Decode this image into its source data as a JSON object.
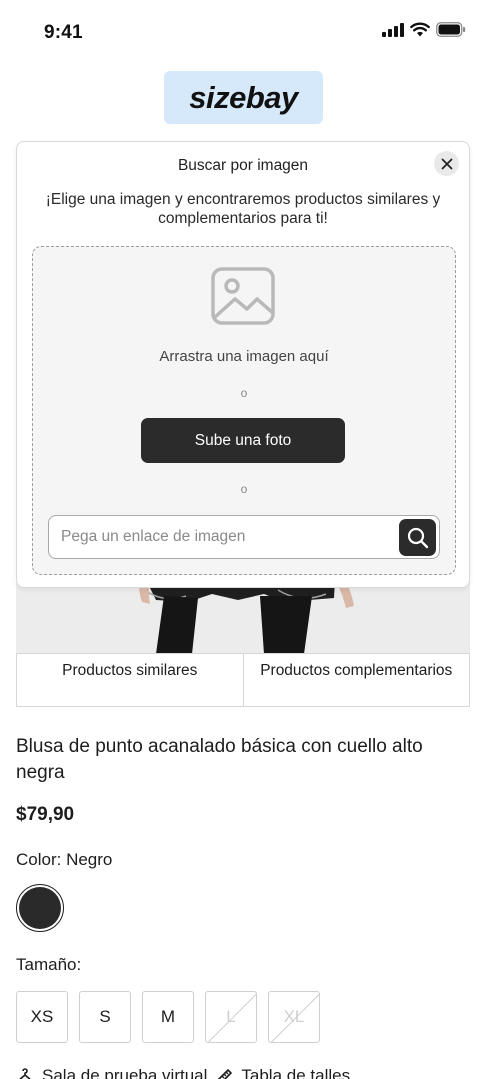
{
  "status_bar": {
    "time": "9:41"
  },
  "brand": {
    "logo_text": "sizebay",
    "accent_color": "#d6e9fb"
  },
  "tabs": [
    {
      "label": "Productos similares"
    },
    {
      "label": "Productos complementarios"
    }
  ],
  "modal": {
    "title": "Buscar por imagen",
    "description": "¡Elige una imagen y encontraremos productos similares y complementarios para ti!",
    "drag_text": "Arrastra una imagen aquí",
    "or_text_1": "o",
    "upload_button": "Sube una foto",
    "or_text_2": "o",
    "url_placeholder": "Pega un enlace de imagen",
    "url_value": "",
    "icons": {
      "close": "close-icon",
      "image": "image-placeholder-icon",
      "search": "search-icon"
    }
  },
  "product": {
    "title": "Blusa de punto acanalado básica con cuello alto negra",
    "price": "$79,90",
    "color_label": "Color: Negro",
    "color_swatch": "#2a2a2a",
    "size_label": "Tamaño:",
    "sizes": [
      {
        "label": "XS",
        "available": true
      },
      {
        "label": "S",
        "available": true
      },
      {
        "label": "M",
        "available": true
      },
      {
        "label": "L",
        "available": false
      },
      {
        "label": "XL",
        "available": false
      }
    ]
  },
  "footer_links": {
    "virtual_fitting": "Sala de prueba virtual",
    "size_chart": "Tabla de talles"
  }
}
